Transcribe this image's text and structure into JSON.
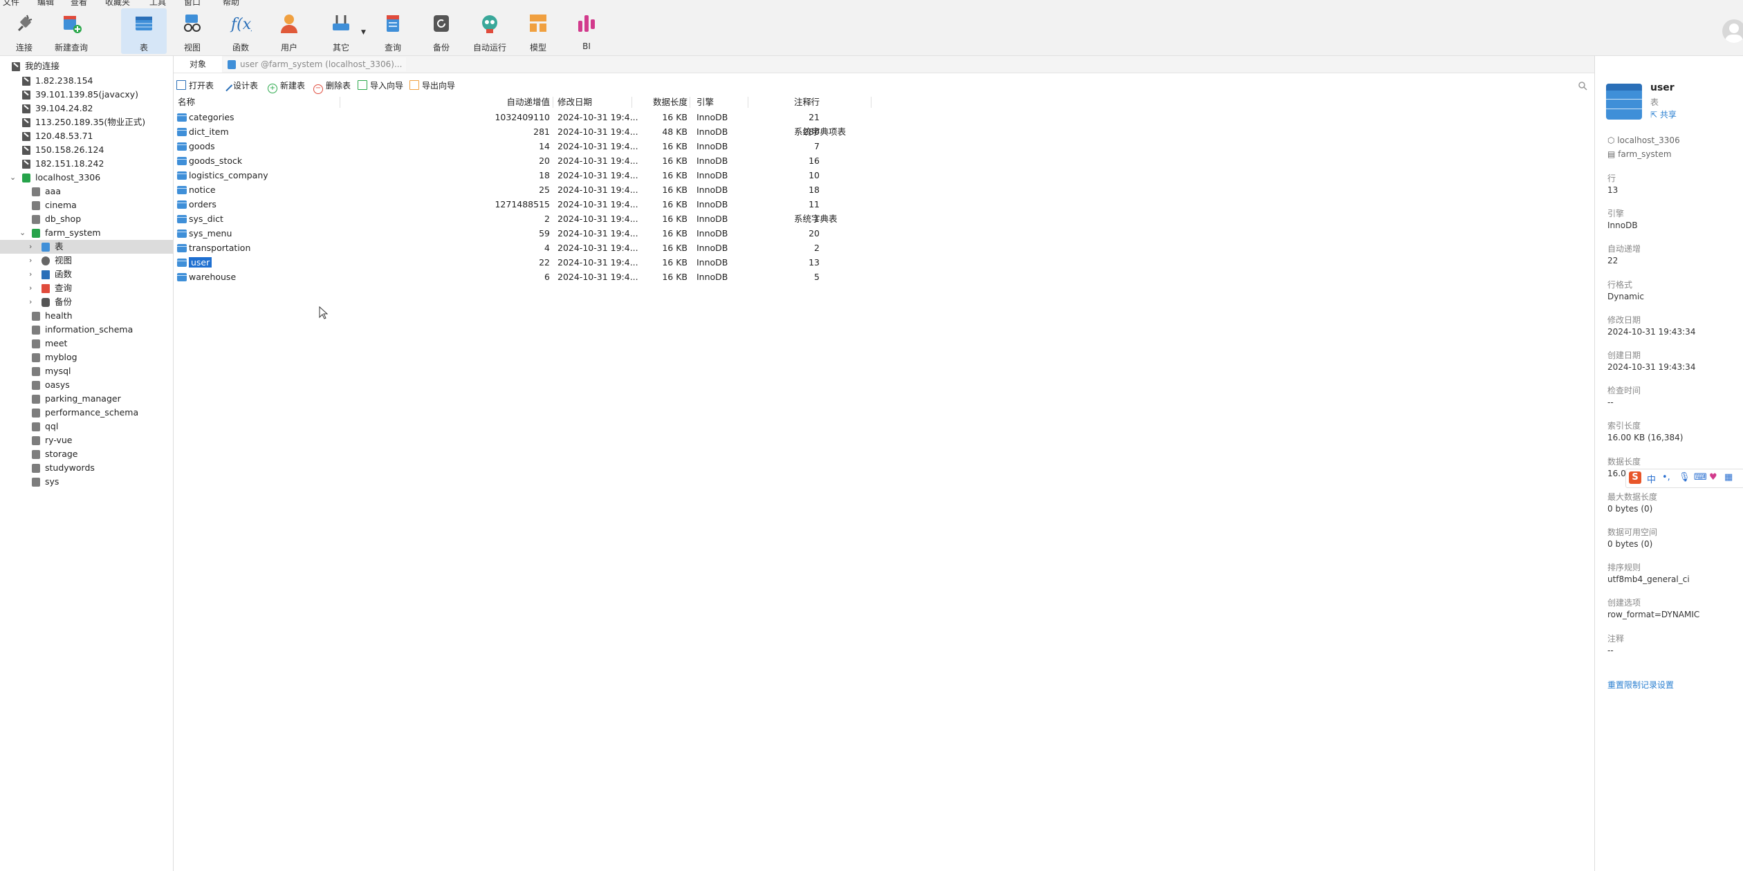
{
  "menu": [
    "文件",
    "编辑",
    "查看",
    "收藏夹",
    "工具",
    "窗口",
    "帮助"
  ],
  "toolbar": {
    "items": [
      "连接",
      "新建查询",
      "表",
      "视图",
      "函数",
      "用户",
      "其它",
      "查询",
      "备份",
      "自动运行",
      "模型",
      "BI"
    ]
  },
  "sidebar": {
    "root": "我的连接",
    "connections": [
      "1.82.238.154",
      "39.101.139.85(javacxy)",
      "39.104.24.82",
      "113.250.189.35(物业正式)",
      "120.48.53.71",
      "150.158.26.124",
      "182.151.18.242",
      "localhost_3306"
    ],
    "dbs_before": [
      "aaa",
      "cinema",
      "db_shop"
    ],
    "active_db": "farm_system",
    "db_children": [
      "表",
      "视图",
      "函数",
      "查询",
      "备份"
    ],
    "dbs_after": [
      "health",
      "information_schema",
      "meet",
      "myblog",
      "mysql",
      "oasys",
      "parking_manager",
      "performance_schema",
      "qql",
      "ry-vue",
      "storage",
      "studywords",
      "sys"
    ]
  },
  "tabs": {
    "objects": "对象",
    "user_tab": "user @farm_system (localhost_3306)..."
  },
  "actions": [
    "打开表",
    "设计表",
    "新建表",
    "删除表",
    "导入向导",
    "导出向导"
  ],
  "grid": {
    "headers": [
      "名称",
      "自动递增值",
      "修改日期",
      "数据长度",
      "引擎",
      "行",
      "注释"
    ],
    "rows": [
      [
        "categories",
        "1032409110",
        "2024-10-31 19:4...",
        "16 KB",
        "InnoDB",
        "21",
        ""
      ],
      [
        "dict_item",
        "281",
        "2024-10-31 19:4...",
        "48 KB",
        "InnoDB",
        "280",
        "系统字典项表"
      ],
      [
        "goods",
        "14",
        "2024-10-31 19:4...",
        "16 KB",
        "InnoDB",
        "7",
        ""
      ],
      [
        "goods_stock",
        "20",
        "2024-10-31 19:4...",
        "16 KB",
        "InnoDB",
        "16",
        ""
      ],
      [
        "logistics_company",
        "18",
        "2024-10-31 19:4...",
        "16 KB",
        "InnoDB",
        "10",
        ""
      ],
      [
        "notice",
        "25",
        "2024-10-31 19:4...",
        "16 KB",
        "InnoDB",
        "18",
        ""
      ],
      [
        "orders",
        "1271488515",
        "2024-10-31 19:4...",
        "16 KB",
        "InnoDB",
        "11",
        ""
      ],
      [
        "sys_dict",
        "2",
        "2024-10-31 19:4...",
        "16 KB",
        "InnoDB",
        "1",
        "系统字典表"
      ],
      [
        "sys_menu",
        "59",
        "2024-10-31 19:4...",
        "16 KB",
        "InnoDB",
        "20",
        ""
      ],
      [
        "transportation",
        "4",
        "2024-10-31 19:4...",
        "16 KB",
        "InnoDB",
        "2",
        ""
      ],
      [
        "user",
        "22",
        "2024-10-31 19:4...",
        "16 KB",
        "InnoDB",
        "13",
        ""
      ],
      [
        "warehouse",
        "6",
        "2024-10-31 19:4...",
        "16 KB",
        "InnoDB",
        "5",
        ""
      ]
    ],
    "selected_row": 10
  },
  "panel": {
    "name": "user",
    "type": "表",
    "share": "共享",
    "connection": "localhost_3306",
    "database": "farm_system",
    "props": [
      {
        "label": "行",
        "value": "13"
      },
      {
        "label": "引擎",
        "value": "InnoDB"
      },
      {
        "label": "自动递增",
        "value": "22"
      },
      {
        "label": "行格式",
        "value": "Dynamic"
      },
      {
        "label": "修改日期",
        "value": "2024-10-31 19:43:34"
      },
      {
        "label": "创建日期",
        "value": "2024-10-31 19:43:34"
      },
      {
        "label": "检查时间",
        "value": "--"
      },
      {
        "label": "索引长度",
        "value": "16.00 KB (16,384)"
      },
      {
        "label": "数据长度",
        "value": "16.00"
      },
      {
        "label": "最大数据长度",
        "value": "0 bytes (0)"
      },
      {
        "label": "数据可用空间",
        "value": "0 bytes (0)"
      },
      {
        "label": "排序规则",
        "value": "utf8mb4_general_ci"
      },
      {
        "label": "创建选项",
        "value": "row_format=DYNAMIC"
      },
      {
        "label": "注释",
        "value": "--"
      }
    ],
    "reset_link": "重置限制记录设置"
  },
  "ime": {
    "label": "中"
  },
  "colors": {
    "accent": "#1e6fd0",
    "selection_bg": "#dcdcdc",
    "active_tool": "#d6e6f7"
  }
}
